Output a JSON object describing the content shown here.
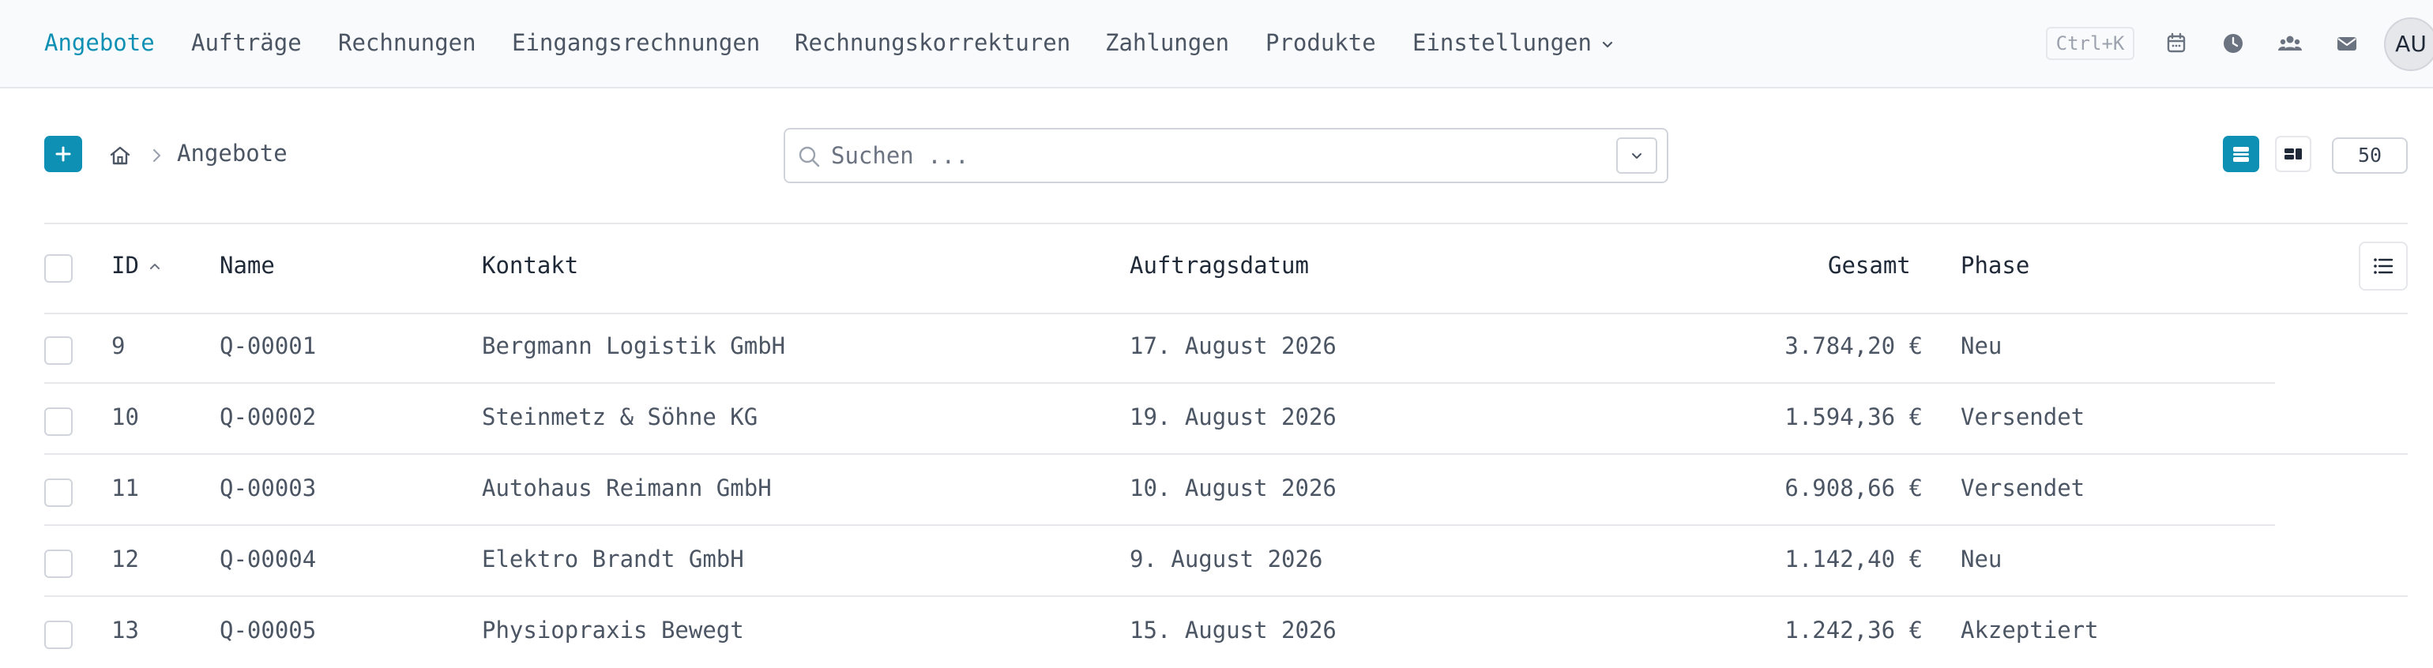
{
  "nav": {
    "items": [
      {
        "label": "Angebote",
        "active": true
      },
      {
        "label": "Aufträge"
      },
      {
        "label": "Rechnungen"
      },
      {
        "label": "Eingangsrechnungen"
      },
      {
        "label": "Rechnungskorrekturen"
      },
      {
        "label": "Zahlungen"
      },
      {
        "label": "Produkte"
      },
      {
        "label": "Einstellungen",
        "dropdown": true
      }
    ],
    "shortcut": "Ctrl+K",
    "icons": [
      "calendar-icon",
      "clock-icon",
      "team-icon",
      "mail-icon"
    ],
    "avatar": "AU"
  },
  "toolbar": {
    "breadcrumb": "Angebote",
    "search_placeholder": "Suchen ...",
    "page_size": "50"
  },
  "colors": {
    "accent": "#0e90b4",
    "border": "#e5e7eb",
    "text": "#4b5563"
  },
  "table": {
    "headers": {
      "id": "ID",
      "name": "Name",
      "contact": "Kontakt",
      "date": "Auftragsdatum",
      "total": "Gesamt",
      "phase": "Phase"
    },
    "sort": {
      "column": "id",
      "direction": "ascending"
    },
    "rows": [
      {
        "id": "9",
        "name": "Q-00001",
        "contact": "Bergmann Logistik GmbH",
        "date": "17. August 2026",
        "total": "3.784,20 €",
        "phase": "Neu"
      },
      {
        "id": "10",
        "name": "Q-00002",
        "contact": "Steinmetz & Söhne KG",
        "date": "19. August 2026",
        "total": "1.594,36 €",
        "phase": "Versendet"
      },
      {
        "id": "11",
        "name": "Q-00003",
        "contact": "Autohaus Reimann GmbH",
        "date": "10. August 2026",
        "total": "6.908,66 €",
        "phase": "Versendet"
      },
      {
        "id": "12",
        "name": "Q-00004",
        "contact": "Elektro Brandt GmbH",
        "date": "9. August 2026",
        "total": "1.142,40 €",
        "phase": "Neu"
      },
      {
        "id": "13",
        "name": "Q-00005",
        "contact": "Physiopraxis Bewegt",
        "date": "15. August 2026",
        "total": "1.242,36 €",
        "phase": "Akzeptiert"
      }
    ]
  }
}
